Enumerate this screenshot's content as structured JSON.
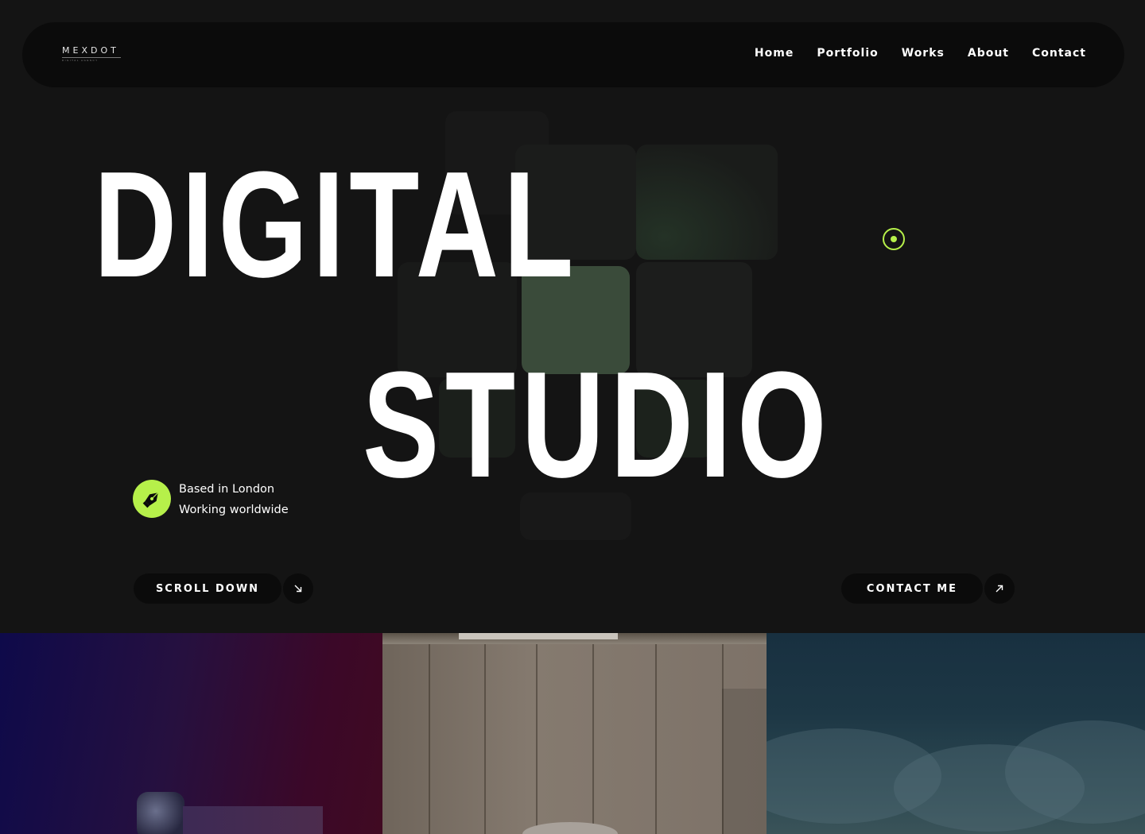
{
  "brand": {
    "name": "MEXDOT",
    "tagline": "DIGITAL AGENCY"
  },
  "nav": {
    "items": [
      "Home",
      "Portfolio",
      "Works",
      "About",
      "Contact"
    ]
  },
  "hero": {
    "line1": "DIGITAL",
    "line2": "STUDIO",
    "location": {
      "line1": "Based in London",
      "line2": "Working worldwide",
      "icon": "pen-nib-icon"
    },
    "accent_color": "#b6f04a"
  },
  "buttons": {
    "scroll": {
      "label": "SCROLL DOWN",
      "icon": "arrow-down-right-icon"
    },
    "contact": {
      "label": "CONTACT ME",
      "icon": "arrow-up-right-icon"
    }
  },
  "colors": {
    "background": "#141414",
    "navbar": "#0b0b0b",
    "accent": "#b6f04a"
  }
}
